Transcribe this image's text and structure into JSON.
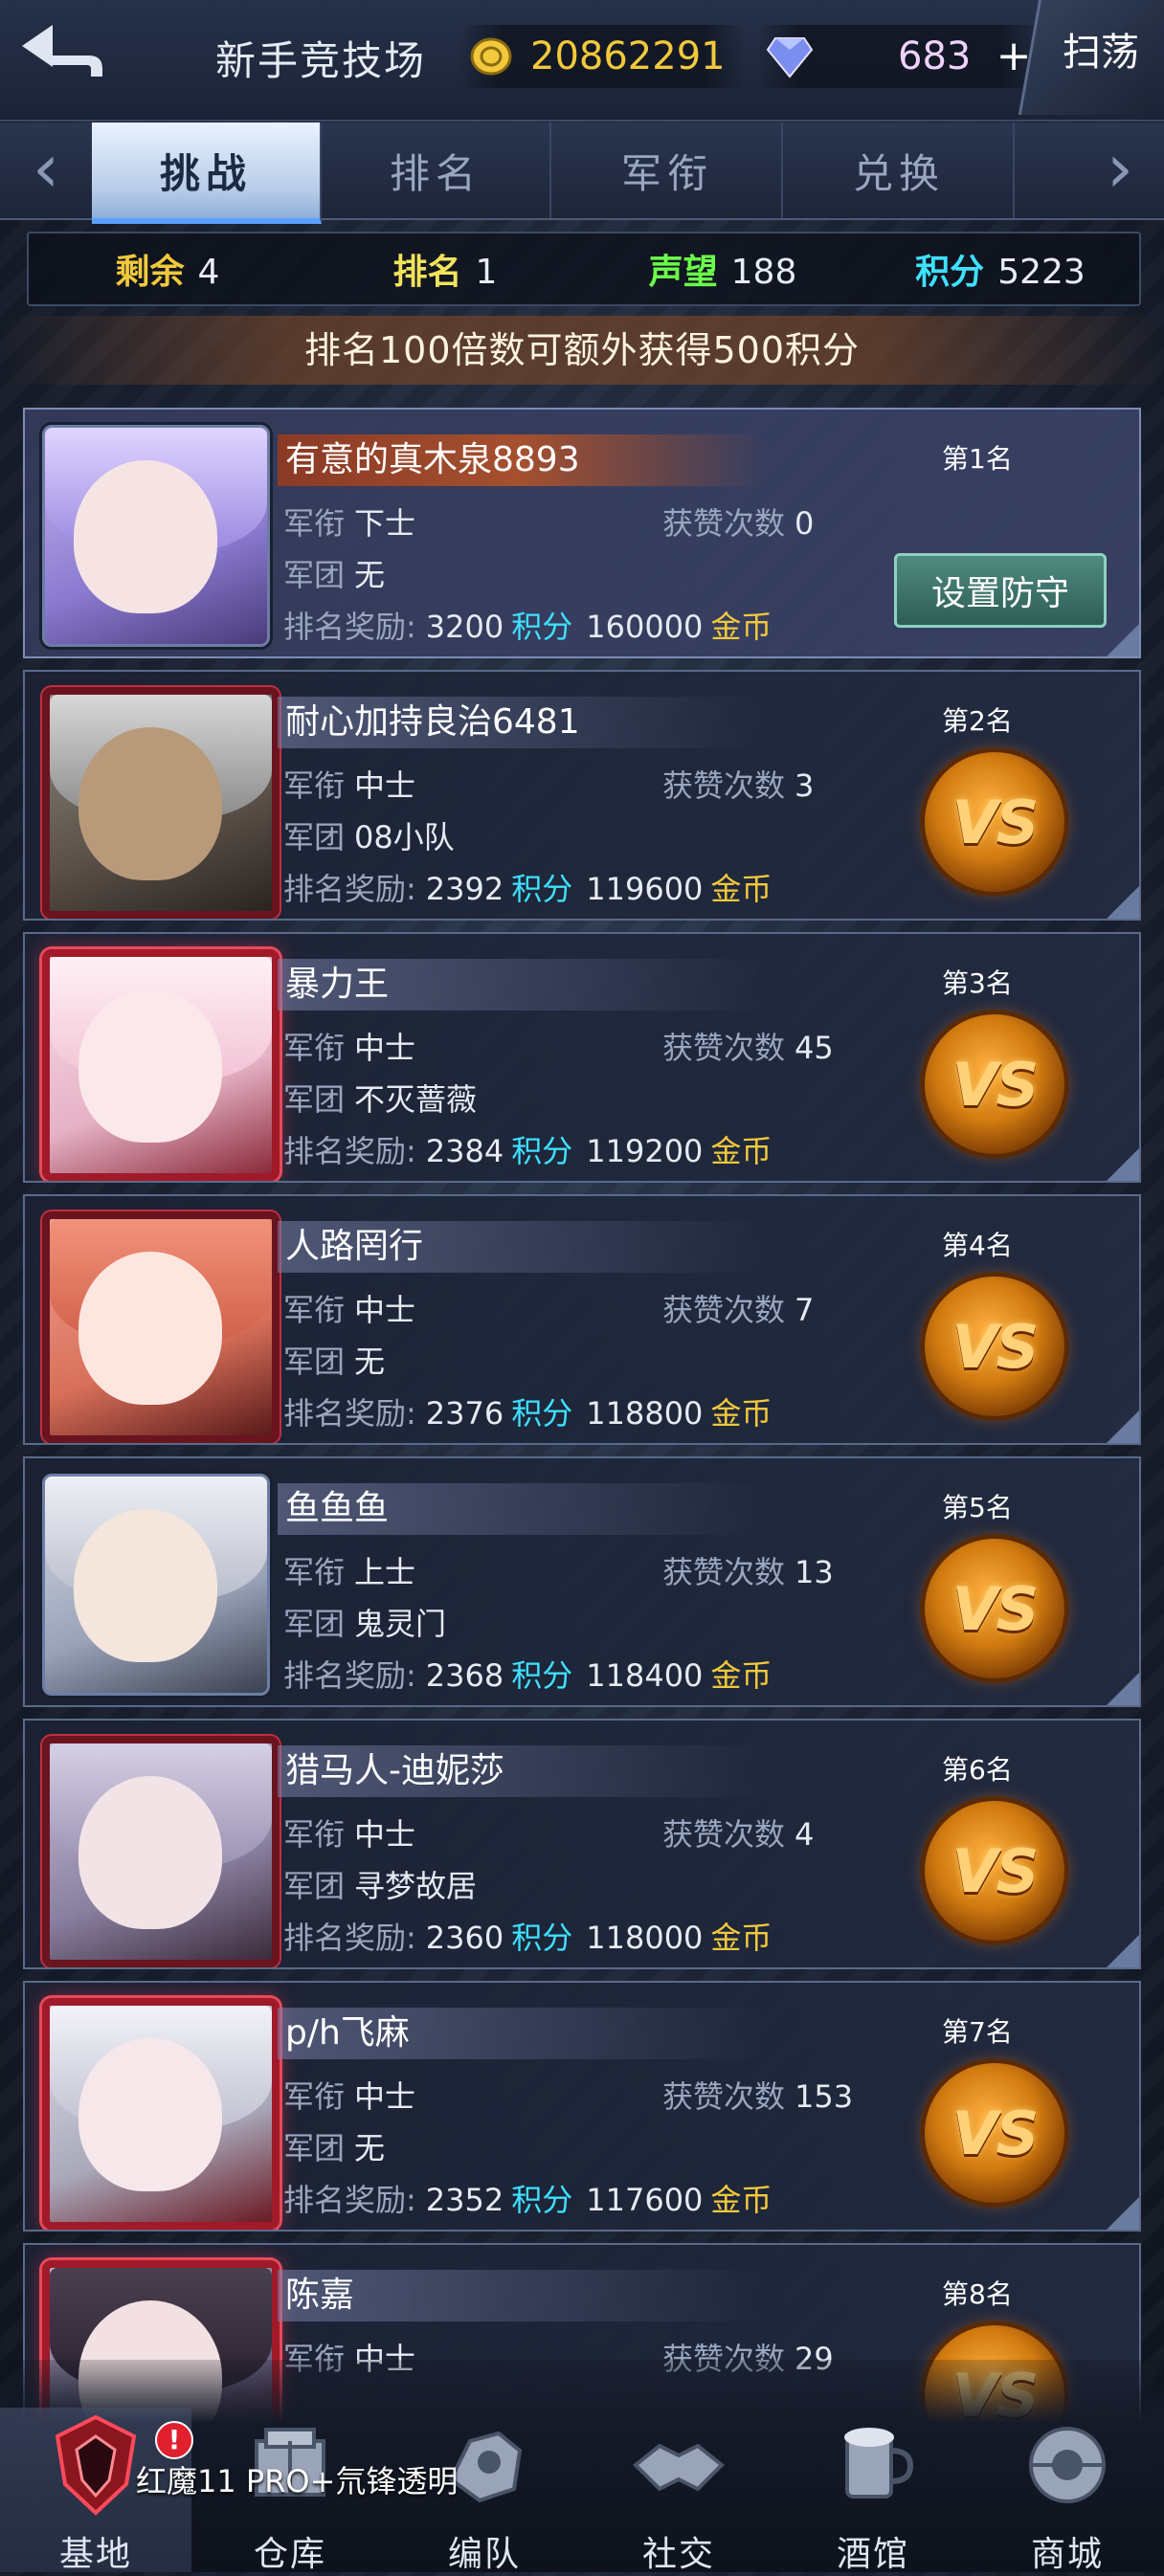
{
  "header": {
    "title": "新手竞技场",
    "gold": "20862291",
    "gems": "683",
    "plus_label": "+",
    "sweep_label": "扫荡"
  },
  "tabs": [
    "挑战",
    "排名",
    "军衔",
    "兑换"
  ],
  "stats": {
    "remaining_label": "剩余",
    "remaining": "4",
    "rank_label": "排名",
    "rank": "1",
    "fame_label": "声望",
    "fame": "188",
    "points_label": "积分",
    "points": "5223"
  },
  "notice": "排名100倍数可额外获得500积分",
  "labels": {
    "rank_title": "军衔",
    "likes": "获赞次数",
    "guild": "军团",
    "reward": "排名奖励:",
    "points": "积分",
    "gold": "金币",
    "defense_button": "设置防守",
    "vs": "VS"
  },
  "players": [
    {
      "name": "有意的真木泉8893",
      "rank_title": "下士",
      "likes": "0",
      "guild": "无",
      "points": "3200",
      "gold": "160000",
      "place": "第1名",
      "self": true
    },
    {
      "name": "耐心加持良治6481",
      "rank_title": "中士",
      "likes": "3",
      "guild": "08小队",
      "points": "2392",
      "gold": "119600",
      "place": "第2名"
    },
    {
      "name": "暴力王",
      "rank_title": "中士",
      "likes": "45",
      "guild": "不灭蔷薇",
      "points": "2384",
      "gold": "119200",
      "place": "第3名"
    },
    {
      "name": "人路罔行",
      "rank_title": "中士",
      "likes": "7",
      "guild": "无",
      "points": "2376",
      "gold": "118800",
      "place": "第4名"
    },
    {
      "name": "鱼鱼鱼",
      "rank_title": "上士",
      "likes": "13",
      "guild": "鬼灵门",
      "points": "2368",
      "gold": "118400",
      "place": "第5名"
    },
    {
      "name": "猎马人-迪妮莎",
      "rank_title": "中士",
      "likes": "4",
      "guild": "寻梦故居",
      "points": "2360",
      "gold": "118000",
      "place": "第6名"
    },
    {
      "name": "p/h飞麻",
      "rank_title": "中士",
      "likes": "153",
      "guild": "无",
      "points": "2352",
      "gold": "117600",
      "place": "第7名"
    },
    {
      "name": "陈嘉",
      "rank_title": "中士",
      "likes": "29",
      "guild": "",
      "points": "",
      "gold": "",
      "place": "第8名"
    }
  ],
  "nav": [
    "基地",
    "仓库",
    "编队",
    "社交",
    "酒馆",
    "商城"
  ],
  "nav_badge": "!",
  "watermark": "红魔11 PRO+氘锋透明",
  "colors": {
    "gold": "#f2c93c",
    "points": "#3ee0ff",
    "fame": "#6cff4a",
    "vs": "#d07a10"
  }
}
